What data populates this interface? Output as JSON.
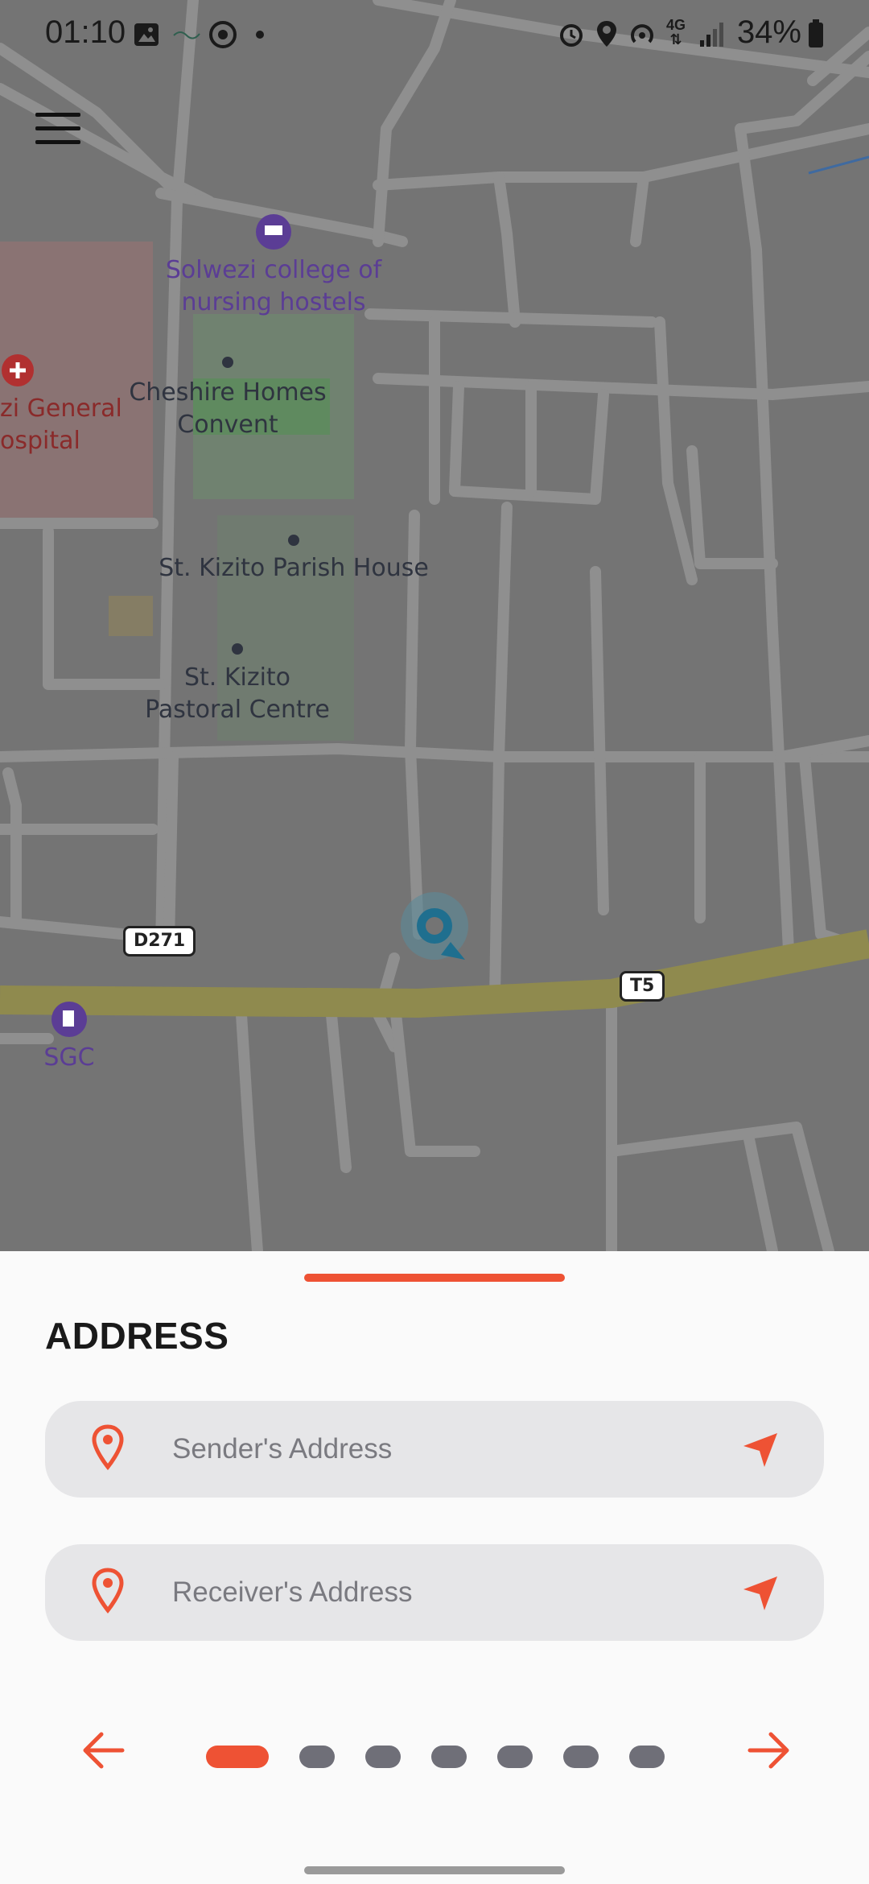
{
  "status_bar": {
    "time": "01:10",
    "network": "4G",
    "battery": "34%"
  },
  "map": {
    "labels": {
      "nursing_hostels": "Solwezi college of\nnursing hostels",
      "hospital": "zi General\nospital",
      "cheshire": "Cheshire Homes\nConvent",
      "kizito_house": "St. Kizito Parish House",
      "kizito_centre": "St. Kizito\nPastoral Centre",
      "sgc": "SGC"
    },
    "shields": {
      "d271": "D271",
      "t5": "T5"
    }
  },
  "sheet": {
    "title": "ADDRESS",
    "sender_placeholder": "Sender's Address",
    "receiver_placeholder": "Receiver's Address",
    "steps_total": 7,
    "step_active": 1
  },
  "colors": {
    "accent": "#ee5234",
    "dot_inactive": "#6f6f78",
    "field_bg": "#e6e6e8"
  }
}
